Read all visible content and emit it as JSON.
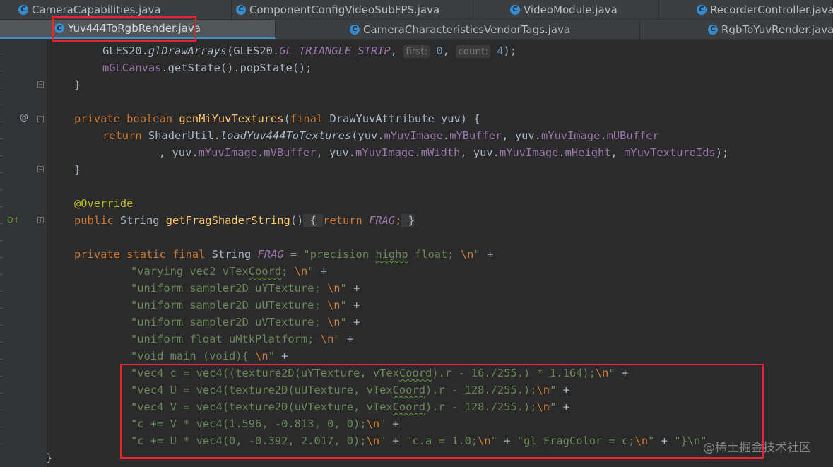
{
  "tabs_row1": [
    {
      "label": "CameraCapabilities.java",
      "icon": "C"
    },
    {
      "label": "ComponentConfigVideoSubFPS.java",
      "icon": "C"
    },
    {
      "label": "VideoModule.java",
      "icon": "C"
    },
    {
      "label": "RecorderController.java",
      "icon": "C"
    }
  ],
  "tabs_row2": [
    {
      "label": "Yuv444ToRgbRender.java",
      "icon": "C",
      "active": true
    },
    {
      "label": "CameraCharacteristicsVendorTags.java",
      "icon": "C"
    },
    {
      "label": "RgbToYuvRender.java",
      "icon": "C"
    }
  ],
  "gutter": {
    "implements_marker": "@",
    "override_marker": "O↑"
  },
  "code": {
    "l1": {
      "t1": "GLES20.",
      "t2": "glDrawArrays",
      "t3": "(GLES20.",
      "t4": "GL_TRIANGLE_STRIP",
      "t5": ", ",
      "hint_first": "first:",
      "n1": "0",
      "t6": ", ",
      "hint_count": "count:",
      "n2": "4",
      "t7": ");"
    },
    "l2": {
      "t1": "mGLCanvas",
      "t2": ".getState().popState();"
    },
    "l3": {
      "t1": "}"
    },
    "l4": {
      "k1": "private",
      "k2": "boolean",
      "fn": "genMiYuvTextures",
      "t1": "(",
      "k3": "final",
      "t2": " DrawYuvAttribute yuv) {"
    },
    "l5": {
      "k1": "return",
      "t1": "ShaderUtil.",
      "t2": "loadYuv444ToTextures",
      "t3": "(yuv.",
      "f1": "mYuvImage",
      "t4": ".",
      "f2": "mYBuffer",
      "t5": ", yuv.",
      "f3": "mYuvImage",
      "t6": ".",
      "f4": "mUBuffer"
    },
    "l6": {
      "t1": ", yuv.",
      "f1": "mYuvImage",
      "t2": ".",
      "f2": "mVBuffer",
      "t3": ", yuv.",
      "f3": "mYuvImage",
      "t4": ".",
      "f4": "mWidth",
      "t5": ", yuv.",
      "f5": "mYuvImage",
      "t6": ".",
      "f6": "mHeight",
      "t7": ", ",
      "f7": "mYuvTextureIds",
      "t8": ");"
    },
    "l7": {
      "t1": "}"
    },
    "l8": {
      "ann": "@Override"
    },
    "l9": {
      "k1": "public",
      "t1": " String ",
      "fn": "getFragShaderString",
      "t2": "()",
      "b1": " { ",
      "k2": "return",
      "f1": "FRAG",
      "t3": ";",
      "b2": " }"
    },
    "l10": {
      "k1": "private",
      "k2": "static",
      "k3": "final",
      "t1": " String ",
      "f1": "FRAG",
      "t2": " = ",
      "s1": "\"precision ",
      "s2": "highp",
      "s3": " float; ",
      "e1": "\\n",
      "s4": "\"",
      "t3": " +"
    },
    "l11": {
      "s1": "\"varying vec2 vTex",
      "s2": "Coord",
      "s3": "; ",
      "e1": "\\n",
      "s4": "\"",
      "t1": " +"
    },
    "l12": {
      "s1": "\"uniform sampler2D uYTexture; ",
      "e1": "\\n",
      "s2": "\"",
      "t1": " +"
    },
    "l13": {
      "s1": "\"uniform sampler2D uUTexture; ",
      "e1": "\\n",
      "s2": "\"",
      "t1": " +"
    },
    "l14": {
      "s1": "\"uniform sampler2D uVTexture; ",
      "e1": "\\n",
      "s2": "\"",
      "t1": " +"
    },
    "l15": {
      "s1": "\"uniform float uMtkPlatform; ",
      "e1": "\\n",
      "s2": "\"",
      "t1": " +"
    },
    "l16": {
      "s1": "\"void main (void){ ",
      "e1": "\\n",
      "s2": "\"",
      "t1": " +"
    },
    "l17": {
      "s1": "\"vec4 c = vec4((texture2D(uYTexture, vTex",
      "s2": "Coord",
      "s3": ").r - 16./255.) * 1.164);",
      "e1": "\\n",
      "s4": "\"",
      "t1": " +"
    },
    "l18": {
      "s1": "\"vec4 U = vec4(texture2D(uUTexture, vTex",
      "s2": "Coord",
      "s3": ").r - 128./255.);",
      "e1": "\\n",
      "s4": "\"",
      "t1": " +"
    },
    "l19": {
      "s1": "\"vec4 V = vec4(texture2D(uVTexture, vTex",
      "s2": "Coord",
      "s3": ").r - 128./255.);",
      "e1": "\\n",
      "s4": "\"",
      "t1": " +"
    },
    "l20": {
      "s1": "\"c += V * vec4(1.596, -0.813, 0, 0);",
      "e1": "\\n",
      "s2": "\"",
      "t1": " +"
    },
    "l21": {
      "s1": "\"c += U * vec4(0, -0.392, 2.017, 0);",
      "e1": "\\n",
      "s2": "\"",
      "t1": " + ",
      "s3": "\"c.a = 1.0;",
      "e2": "\\n",
      "s4": "\"",
      "t2": " + ",
      "s5": "\"gl_FragColor = c;",
      "e3": "\\n",
      "s6": "\"",
      "t3": " + ",
      "s7": "\"}\\n\""
    },
    "l22": {
      "t1": "}"
    }
  },
  "watermark": "@稀土掘金技术社区",
  "colors": {
    "background": "#2b2b2b",
    "keyword": "#cc7832",
    "function": "#ffc66d",
    "string": "#6a8759",
    "number": "#6897bb",
    "field": "#9876aa",
    "annotation": "#bbb529",
    "highlight_box": "#e8262a"
  }
}
